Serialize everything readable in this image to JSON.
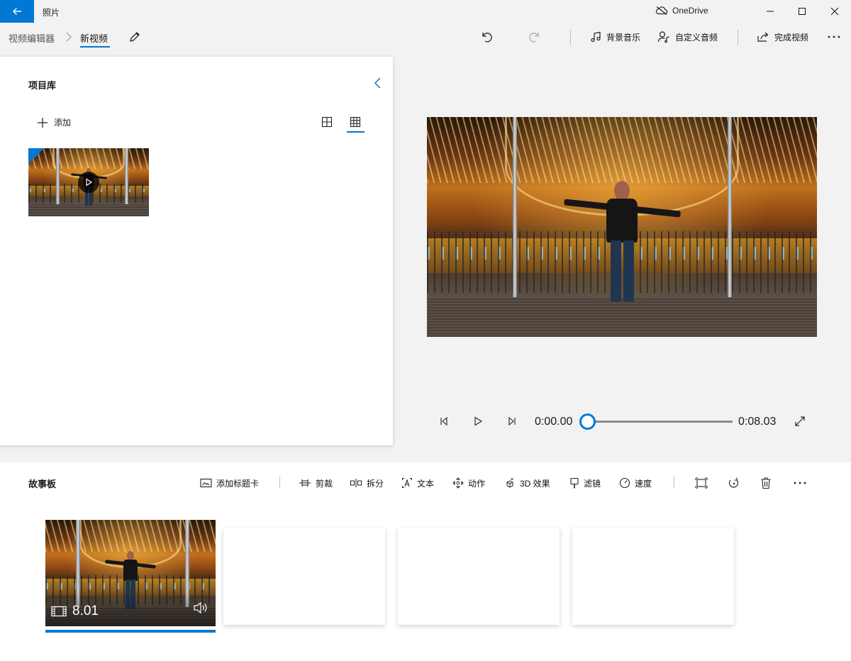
{
  "titlebar": {
    "app_title": "照片",
    "onedrive_label": "OneDrive"
  },
  "toolbar": {
    "breadcrumb_root": "视频编辑器",
    "breadcrumb_current": "新视频",
    "background_music": "背景音乐",
    "custom_audio": "自定义音频",
    "finish_video": "完成视频"
  },
  "library": {
    "title": "项目库",
    "add_label": "添加"
  },
  "player": {
    "current_time": "0:00.00",
    "total_time": "0:08.03",
    "progress": 0
  },
  "storyboard": {
    "title": "故事板",
    "tools": {
      "add_title_card": "添加标题卡",
      "trim": "剪裁",
      "split": "拆分",
      "text": "文本",
      "motion": "动作",
      "effects_3d": "3D 效果",
      "filters": "滤镜",
      "speed": "速度"
    },
    "clip": {
      "duration": "8.01"
    }
  },
  "colors": {
    "accent": "#0078d4",
    "chrome_bg": "#f2f2f2"
  }
}
